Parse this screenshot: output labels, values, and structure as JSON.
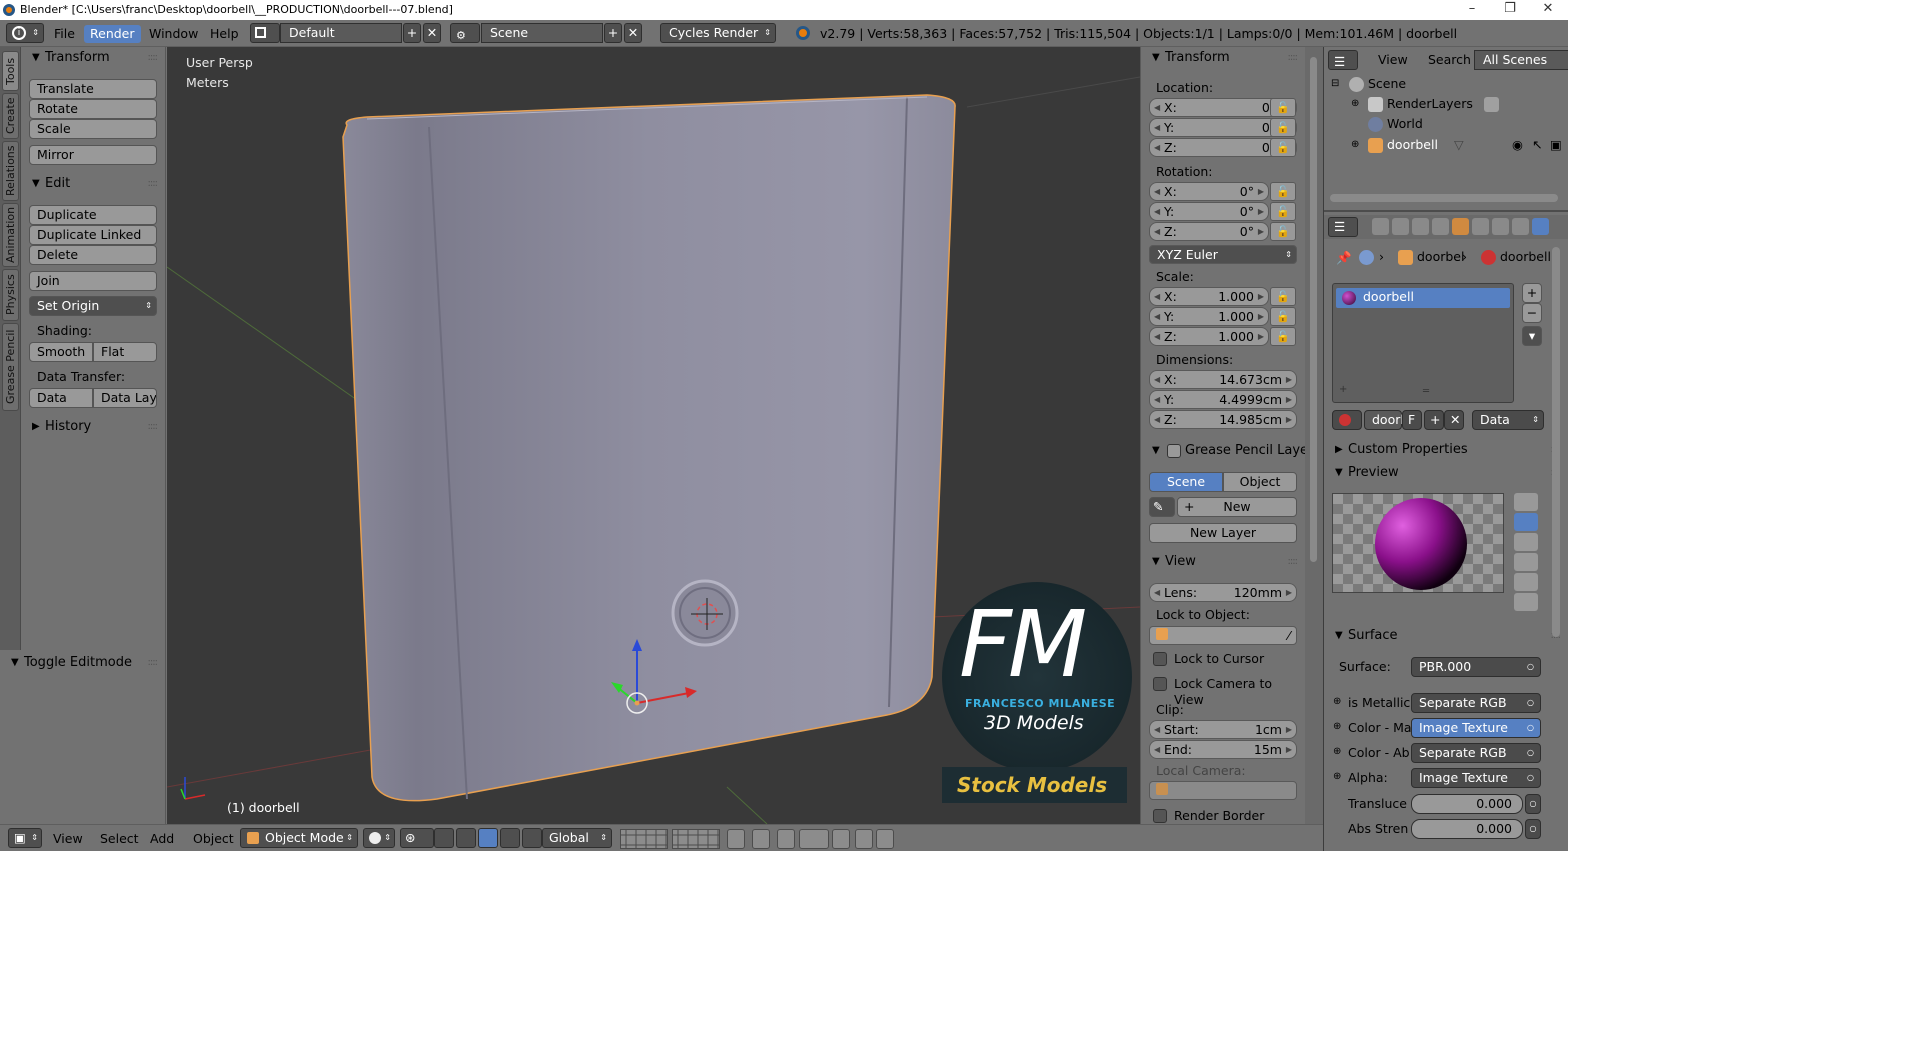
{
  "titlebar": {
    "title": "Blender* [C:\\Users\\franc\\Desktop\\doorbell\\__PRODUCTION\\doorbell---07.blend]",
    "minimize": "–",
    "maximize": "❐",
    "close": "✕"
  },
  "header": {
    "menus": [
      "File",
      "Render",
      "Window",
      "Help"
    ],
    "active_menu": "Render",
    "screen_layout": "Default",
    "scene": "Scene",
    "engine": "Cycles Render",
    "stats": "v2.79 | Verts:58,363 | Faces:57,752 | Tris:115,504 | Objects:1/1 | Lamps:0/0 | Mem:101.46M | doorbell"
  },
  "tool_tabs": [
    "Tools",
    "Create",
    "Relations",
    "Animation",
    "Physics",
    "Grease Pencil"
  ],
  "tool_shelf": {
    "transform_title": "Transform",
    "translate": "Translate",
    "rotate": "Rotate",
    "scale": "Scale",
    "mirror": "Mirror",
    "edit_title": "Edit",
    "duplicate": "Duplicate",
    "duplicate_linked": "Duplicate Linked",
    "delete": "Delete",
    "join": "Join",
    "set_origin": "Set Origin",
    "shading_label": "Shading:",
    "smooth": "Smooth",
    "flat": "Flat",
    "data_transfer_label": "Data Transfer:",
    "data": "Data",
    "data_layout": "Data Layo",
    "history_title": "History",
    "toggle_editmode": "Toggle Editmode"
  },
  "viewport": {
    "view_name": "User Persp",
    "units": "Meters",
    "object_label": "(1) doorbell",
    "logo": {
      "initials": "FM",
      "name": "FRANCESCO MILANESE",
      "tagline": "3D Models",
      "badge": "Stock Models"
    }
  },
  "npanel": {
    "transform_title": "Transform",
    "location_label": "Location:",
    "location": [
      {
        "axis": "X:",
        "value": "0m"
      },
      {
        "axis": "Y:",
        "value": "0m"
      },
      {
        "axis": "Z:",
        "value": "0m"
      }
    ],
    "rotation_label": "Rotation:",
    "rotation": [
      {
        "axis": "X:",
        "value": "0°"
      },
      {
        "axis": "Y:",
        "value": "0°"
      },
      {
        "axis": "Z:",
        "value": "0°"
      }
    ],
    "rotation_mode": "XYZ Euler",
    "scale_label": "Scale:",
    "scale": [
      {
        "axis": "X:",
        "value": "1.000"
      },
      {
        "axis": "Y:",
        "value": "1.000"
      },
      {
        "axis": "Z:",
        "value": "1.000"
      }
    ],
    "dimensions_label": "Dimensions:",
    "dimensions": [
      {
        "axis": "X:",
        "value": "14.673cm"
      },
      {
        "axis": "Y:",
        "value": "4.4999cm"
      },
      {
        "axis": "Z:",
        "value": "14.985cm"
      }
    ],
    "grease_title": "Grease Pencil Layer",
    "gp_scene": "Scene",
    "gp_object": "Object",
    "gp_new": "New",
    "gp_new_layer": "New Layer",
    "view_title": "View",
    "lens_label": "Lens:",
    "lens_value": "120mm",
    "lock_object_label": "Lock to Object:",
    "lock_cursor": "Lock to Cursor",
    "lock_camera": "Lock Camera to View",
    "clip_label": "Clip:",
    "clip_start_label": "Start:",
    "clip_start": "1cm",
    "clip_end_label": "End:",
    "clip_end": "15m",
    "local_camera_label": "Local Camera:",
    "render_border": "Render Border"
  },
  "outliner": {
    "view": "View",
    "search": "Search",
    "filter": "All Scenes",
    "items": [
      "Scene",
      "RenderLayers",
      "World",
      "doorbell"
    ]
  },
  "properties": {
    "breadcrumb_object": "doorbel",
    "breadcrumb_material": "doorbell",
    "material_slot": "doorbell",
    "material_name_short": "doorb",
    "fake_user": "F",
    "link": "Data",
    "custom_properties": "Custom Properties",
    "preview": "Preview",
    "surface_title": "Surface",
    "surface_label": "Surface:",
    "surface_value": "PBR.000",
    "inputs": [
      {
        "label": "is Metallic",
        "value": "Separate RGB"
      },
      {
        "label": "Color - Ma",
        "value": "Image Texture"
      },
      {
        "label": "Color - Ab",
        "value": "Separate RGB"
      },
      {
        "label": "Alpha:",
        "value": "Image Texture"
      }
    ],
    "translucence_label": "Transluce",
    "translucence_value": "0.000",
    "abs_strength_label": "Abs Stren",
    "abs_strength_value": "0.000"
  },
  "bottombar": {
    "menus": [
      "View",
      "Select",
      "Add",
      "Object"
    ],
    "mode": "Object Mode",
    "orientation": "Global"
  },
  "colors": {
    "panel": "#727272",
    "viewport": "#393939",
    "selection": "#5680c2",
    "object": "#8e8d9e",
    "outline": "#e8a050",
    "logo_bg": "#1a2a2e",
    "logo_text": "#3ab0e0",
    "badge_text": "#e8c040"
  }
}
